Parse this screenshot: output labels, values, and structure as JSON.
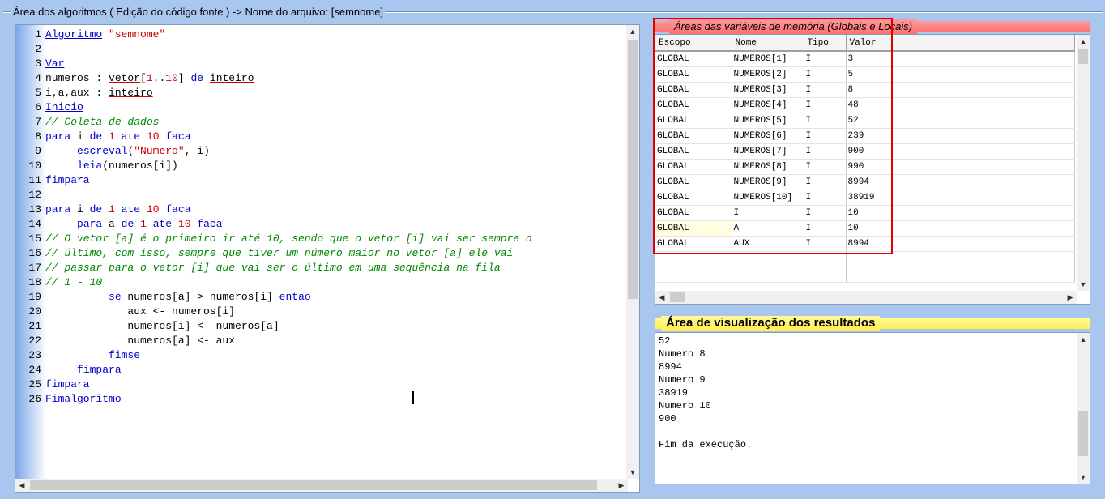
{
  "editor": {
    "title": "Área dos algoritmos ( Edição do código fonte ) -> Nome do arquivo: [semnome]",
    "lines": [
      {
        "n": "1",
        "tokens": [
          [
            "kwu",
            "Algoritmo"
          ],
          [
            "tx",
            " "
          ],
          [
            "str",
            "\"semnome\""
          ]
        ]
      },
      {
        "n": "2",
        "tokens": []
      },
      {
        "n": "3",
        "tokens": [
          [
            "kwu",
            "Var"
          ]
        ]
      },
      {
        "n": "4",
        "tokens": [
          [
            "tx",
            "numeros : "
          ],
          [
            "ty",
            "vetor"
          ],
          [
            "tx",
            "["
          ],
          [
            "num",
            "1"
          ],
          [
            "tx",
            ".."
          ],
          [
            "num",
            "10"
          ],
          [
            "tx",
            "] "
          ],
          [
            "kw",
            "de"
          ],
          [
            "tx",
            " "
          ],
          [
            "ty",
            "inteiro"
          ]
        ]
      },
      {
        "n": "5",
        "tokens": [
          [
            "tx",
            "i,a,aux : "
          ],
          [
            "ty",
            "inteiro"
          ]
        ]
      },
      {
        "n": "6",
        "tokens": [
          [
            "kwu",
            "Inicio"
          ]
        ]
      },
      {
        "n": "7",
        "tokens": [
          [
            "cm",
            "// Coleta de dados"
          ]
        ]
      },
      {
        "n": "8",
        "tokens": [
          [
            "kw",
            "para"
          ],
          [
            "tx",
            " i "
          ],
          [
            "kw",
            "de"
          ],
          [
            "tx",
            " "
          ],
          [
            "num",
            "1"
          ],
          [
            "tx",
            " "
          ],
          [
            "kw",
            "ate"
          ],
          [
            "tx",
            " "
          ],
          [
            "num",
            "10"
          ],
          [
            "tx",
            " "
          ],
          [
            "kw",
            "faca"
          ]
        ]
      },
      {
        "n": "9",
        "tokens": [
          [
            "tx",
            "     "
          ],
          [
            "kw",
            "escreval"
          ],
          [
            "tx",
            "("
          ],
          [
            "str",
            "\"Numero\""
          ],
          [
            "tx",
            ", i)"
          ]
        ]
      },
      {
        "n": "10",
        "tokens": [
          [
            "tx",
            "     "
          ],
          [
            "kw",
            "leia"
          ],
          [
            "tx",
            "(numeros[i])"
          ]
        ]
      },
      {
        "n": "11",
        "tokens": [
          [
            "kw",
            "fimpara"
          ]
        ]
      },
      {
        "n": "12",
        "tokens": []
      },
      {
        "n": "13",
        "tokens": [
          [
            "kw",
            "para"
          ],
          [
            "tx",
            " i "
          ],
          [
            "kw",
            "de"
          ],
          [
            "tx",
            " "
          ],
          [
            "num",
            "1"
          ],
          [
            "tx",
            " "
          ],
          [
            "kw",
            "ate"
          ],
          [
            "tx",
            " "
          ],
          [
            "num",
            "10"
          ],
          [
            "tx",
            " "
          ],
          [
            "kw",
            "faca"
          ]
        ]
      },
      {
        "n": "14",
        "tokens": [
          [
            "tx",
            "     "
          ],
          [
            "kw",
            "para"
          ],
          [
            "tx",
            " a "
          ],
          [
            "kw",
            "de"
          ],
          [
            "tx",
            " "
          ],
          [
            "num",
            "1"
          ],
          [
            "tx",
            " "
          ],
          [
            "kw",
            "ate"
          ],
          [
            "tx",
            " "
          ],
          [
            "num",
            "10"
          ],
          [
            "tx",
            " "
          ],
          [
            "kw",
            "faca"
          ]
        ]
      },
      {
        "n": "15",
        "tokens": [
          [
            "cm",
            "// O vetor [a] é o primeiro ir até 10, sendo que o vetor [i] vai ser sempre o"
          ]
        ]
      },
      {
        "n": "16",
        "tokens": [
          [
            "cm",
            "// último, com isso, sempre que tiver um número maior no vetor [a] ele vai"
          ]
        ]
      },
      {
        "n": "17",
        "tokens": [
          [
            "cm",
            "// passar para o vetor [i] que vai ser o último em uma sequência na fila"
          ]
        ]
      },
      {
        "n": "18",
        "tokens": [
          [
            "cm",
            "// 1 - 10"
          ]
        ]
      },
      {
        "n": "19",
        "tokens": [
          [
            "tx",
            "          "
          ],
          [
            "kw",
            "se"
          ],
          [
            "tx",
            " numeros[a] > numeros[i] "
          ],
          [
            "kw",
            "entao"
          ]
        ]
      },
      {
        "n": "20",
        "tokens": [
          [
            "tx",
            "             aux <- numeros[i]"
          ]
        ]
      },
      {
        "n": "21",
        "tokens": [
          [
            "tx",
            "             numeros[i] <- numeros[a]"
          ]
        ]
      },
      {
        "n": "22",
        "tokens": [
          [
            "tx",
            "             numeros[a] <- aux"
          ]
        ]
      },
      {
        "n": "23",
        "tokens": [
          [
            "tx",
            "          "
          ],
          [
            "kw",
            "fimse"
          ]
        ]
      },
      {
        "n": "24",
        "tokens": [
          [
            "tx",
            "     "
          ],
          [
            "kw",
            "fimpara"
          ]
        ]
      },
      {
        "n": "25",
        "tokens": [
          [
            "kw",
            "fimpara"
          ]
        ]
      },
      {
        "n": "26",
        "tokens": [
          [
            "kwu",
            "Fimalgoritmo"
          ]
        ]
      }
    ]
  },
  "variables": {
    "title": "Áreas das variáveis de memória (Globais e Locais)",
    "columns": [
      "Escopo",
      "Nome",
      "Tipo",
      "Valor"
    ],
    "rows": [
      [
        "GLOBAL",
        "NUMEROS[1]",
        "I",
        "3"
      ],
      [
        "GLOBAL",
        "NUMEROS[2]",
        "I",
        "5"
      ],
      [
        "GLOBAL",
        "NUMEROS[3]",
        "I",
        "8"
      ],
      [
        "GLOBAL",
        "NUMEROS[4]",
        "I",
        "48"
      ],
      [
        "GLOBAL",
        "NUMEROS[5]",
        "I",
        "52"
      ],
      [
        "GLOBAL",
        "NUMEROS[6]",
        "I",
        "239"
      ],
      [
        "GLOBAL",
        "NUMEROS[7]",
        "I",
        "900"
      ],
      [
        "GLOBAL",
        "NUMEROS[8]",
        "I",
        "990"
      ],
      [
        "GLOBAL",
        "NUMEROS[9]",
        "I",
        "8994"
      ],
      [
        "GLOBAL",
        "NUMEROS[10]",
        "I",
        "38919"
      ],
      [
        "GLOBAL",
        "I",
        "I",
        "10"
      ],
      [
        "GLOBAL",
        "A",
        "I",
        "10"
      ],
      [
        "GLOBAL",
        "AUX",
        "I",
        "8994"
      ]
    ],
    "selected_row": 11
  },
  "results": {
    "title": "Área de visualização dos resultados",
    "lines": [
      "52",
      "Numero 8",
      "8994",
      "Numero 9",
      "38919",
      "Numero 10",
      "900",
      "",
      "Fim da execução."
    ]
  },
  "colors": {
    "background": "#a9c7ee",
    "variables_header": "#ff7777",
    "results_header": "#fff36b",
    "highlight_box": "#e00000"
  }
}
